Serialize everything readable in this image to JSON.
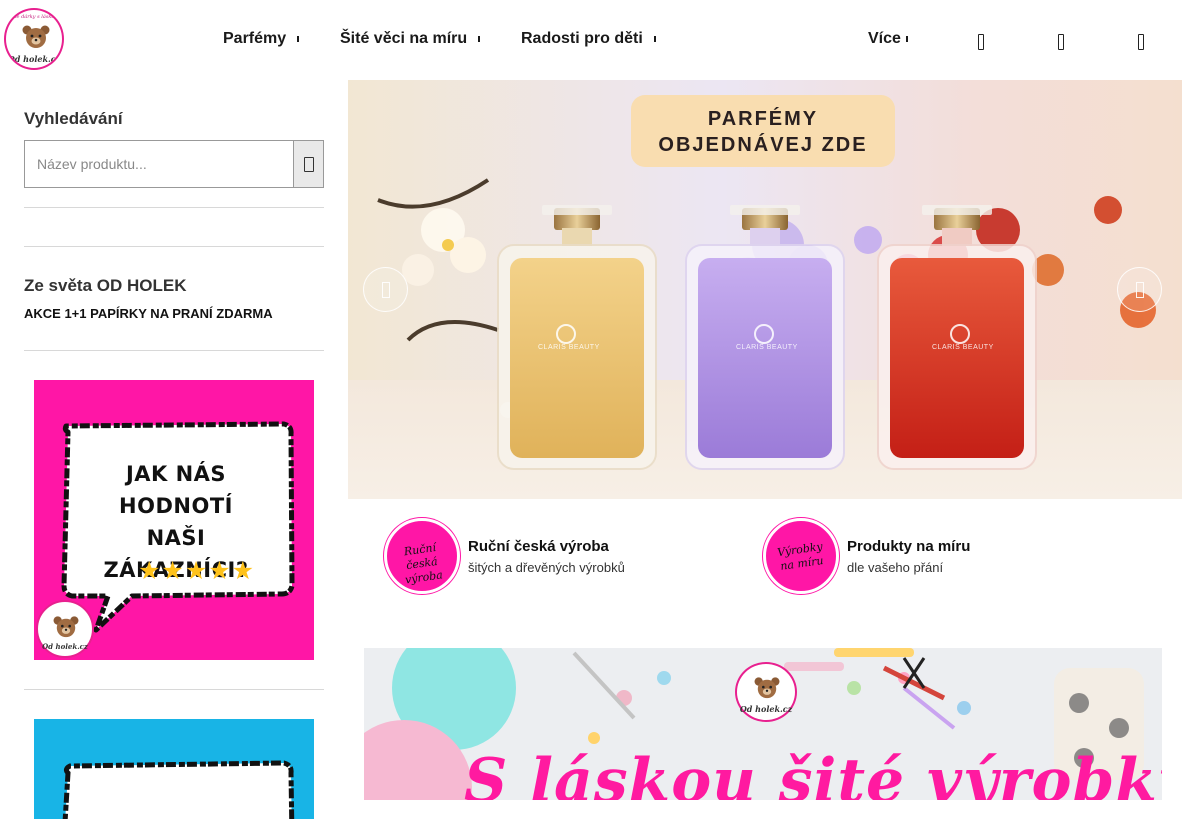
{
  "header": {
    "logo_text": "Od holek.cz",
    "logo_tagline": "šité dárky s láskou",
    "nav": [
      {
        "label": "Parfémy"
      },
      {
        "label": "Šité věci na míru"
      },
      {
        "label": "Radosti pro děti"
      },
      {
        "label": "Více"
      }
    ],
    "icons": [
      "user-icon",
      "heart-icon",
      "cart-icon"
    ]
  },
  "sidebar": {
    "search_title": "Vyhledávání",
    "search_placeholder": "Název produktu...",
    "search_icon": "search-icon",
    "section_title": "Ze světa OD HOLEK",
    "promo_link": "AKCE 1+1 PAPÍRKY NA PRANÍ ZDARMA",
    "review_banner": {
      "line1": "JAK NÁS HODNOTÍ",
      "line2": "NAŠI ZÁKAZNÍCI?",
      "stars": "★★★★★",
      "rating": 5,
      "logo_text": "Od holek.cz",
      "bg_color": "#ff16a6"
    },
    "second_banner": {
      "bg_color": "#18b4e6"
    }
  },
  "hero": {
    "cta_line1": "PARFÉMY",
    "cta_line2": "OBJEDNÁVEJ ZDE",
    "bottle_brand": "CLARIS BEAUTY",
    "prev_icon": "chevron-left-icon",
    "next_icon": "chevron-right-icon",
    "colors": {
      "gold": "#e8c068",
      "violet": "#a884e0",
      "red": "#d22c1e"
    }
  },
  "features": [
    {
      "badge": "Ruční česká výroba",
      "title": "Ruční česká výroba",
      "subtitle": "šitých a dřevěných výrobků"
    },
    {
      "badge": "Výrobky na míru",
      "title": "Produkty na míru",
      "subtitle": "dle vašeho přání"
    }
  ],
  "craft_banner": {
    "headline": "S láskou šité výrobky",
    "logo_text": "Od holek.cz",
    "accent": "#ff1aa0"
  }
}
